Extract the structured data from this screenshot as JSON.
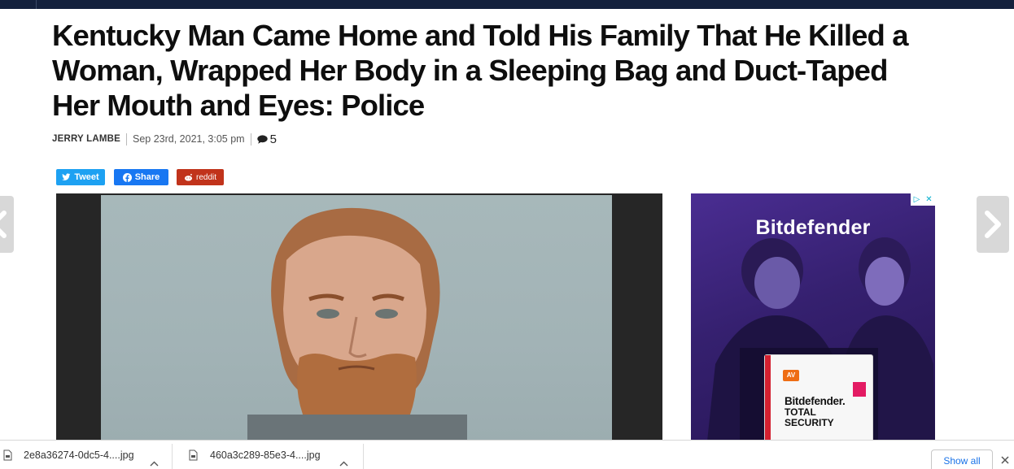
{
  "article": {
    "headline": "Kentucky Man Came Home and Told His Family That He Killed a Woman, Wrapped Her Body in a Sleeping Bag and Duct-Taped Her Mouth and Eyes: Police",
    "author": "JERRY LAMBE",
    "date": "Sep 23rd, 2021, 3:05 pm",
    "comment_count": "5"
  },
  "share": {
    "tweet_label": "Tweet",
    "facebook_label": "Share",
    "reddit_label": "reddit"
  },
  "ad": {
    "brand": "Bitdefender",
    "product_brand": "Bitdefender.",
    "product_line1": "TOTAL",
    "product_line2": "SECURITY",
    "badge": "AV"
  },
  "downloads": {
    "items": [
      {
        "filename": "2e8a36274-0dc5-4....jpg"
      },
      {
        "filename": "460a3c289-85e3-4....jpg"
      }
    ],
    "show_all_label": "Show all"
  },
  "colors": {
    "top_bar": "#14213d",
    "twitter": "#1da1f2",
    "facebook": "#1877f2",
    "reddit": "#c1331b",
    "ad_purple": "#35206f"
  }
}
